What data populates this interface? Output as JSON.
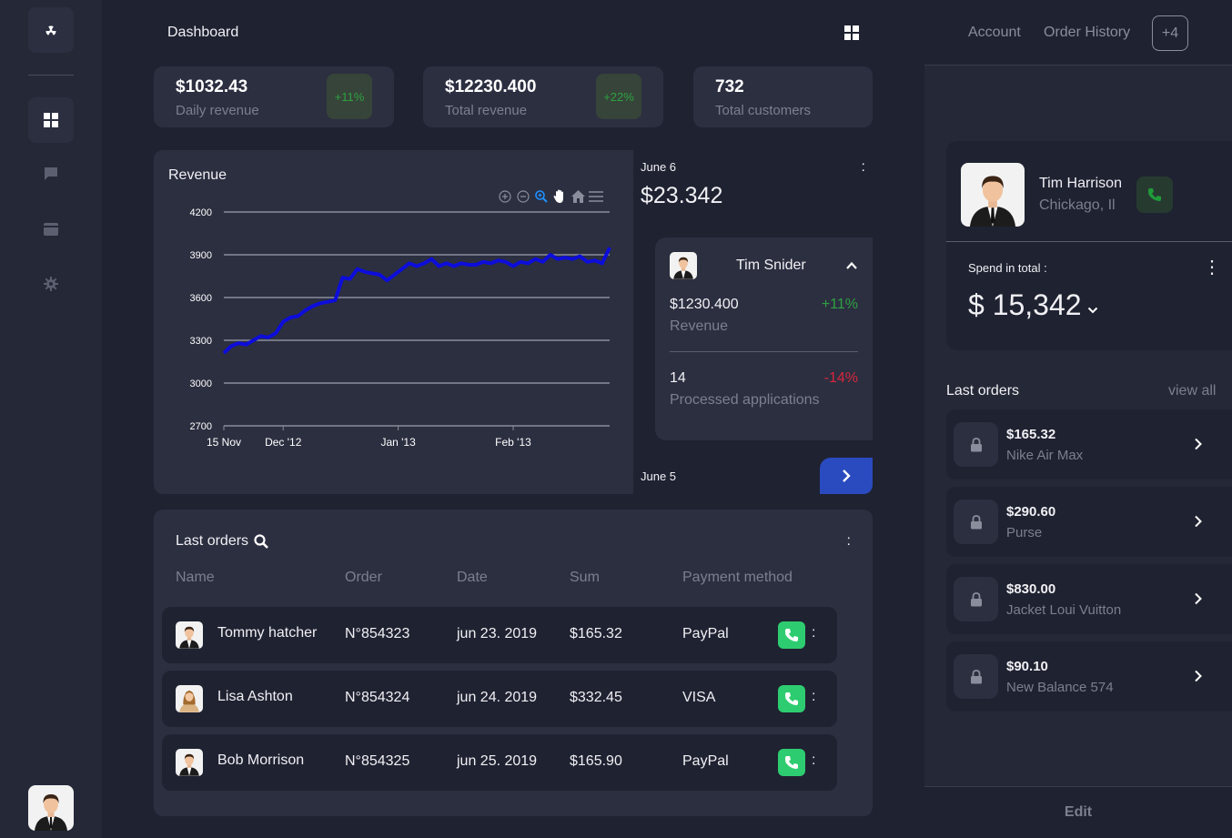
{
  "colors": {
    "background": "#1f2231",
    "card": "#2c2f40",
    "sidebar": "#252837",
    "accent_blue": "#2a4bbf",
    "chart_line": "#0d0ddb",
    "positive": "#2ea142",
    "negative": "#d7263d",
    "phone_green": "#2ecc71"
  },
  "sidebar": {
    "logo_icon": "radiation-icon",
    "items": [
      {
        "icon": "grid-icon",
        "active": true
      },
      {
        "icon": "chat-icon",
        "active": false
      },
      {
        "icon": "card-icon",
        "active": false
      },
      {
        "icon": "gear-icon",
        "active": false
      }
    ]
  },
  "header": {
    "title": "Dashboard",
    "toggle_icon": "grid-icon"
  },
  "stats": [
    {
      "value": "$1032.43",
      "label": "Daily revenue",
      "change": "+11%"
    },
    {
      "value": "$12230.400",
      "label": "Total revenue",
      "change": "+22%"
    },
    {
      "value": "732",
      "label": "Total customers"
    }
  ],
  "revenue": {
    "title": "Revenue",
    "toolbar": [
      "zoom-in-icon",
      "zoom-out-icon",
      "selection-zoom-icon",
      "pan-hand-icon",
      "home-icon",
      "menu-icon"
    ]
  },
  "chart_data": {
    "type": "line",
    "title": "Revenue",
    "xlabel": "",
    "ylabel": "",
    "ylim": [
      2700,
      4200
    ],
    "yticks": [
      2700,
      3000,
      3300,
      3600,
      3900,
      4200
    ],
    "xticks": [
      {
        "label": "15 Nov",
        "date": "2011-11-15"
      },
      {
        "label": "Dec '12",
        "date": "2011-12-01"
      },
      {
        "label": "Jan '13",
        "date": "2012-01-01"
      },
      {
        "label": "Feb '13",
        "date": "2012-02-01"
      }
    ],
    "x_range": [
      "2011-11-15",
      "2012-02-27"
    ],
    "grid": true,
    "series": [
      {
        "name": "",
        "x": [
          "2011-11-15",
          "2011-11-17",
          "2011-11-19",
          "2011-11-21",
          "2011-11-23",
          "2011-11-25",
          "2011-11-27",
          "2011-11-29",
          "2011-12-01",
          "2011-12-03",
          "2011-12-05",
          "2011-12-07",
          "2011-12-09",
          "2011-12-11",
          "2011-12-13",
          "2011-12-15",
          "2011-12-17",
          "2011-12-19",
          "2011-12-21",
          "2011-12-23",
          "2011-12-25",
          "2011-12-27",
          "2011-12-29",
          "2011-12-31",
          "2012-01-02",
          "2012-01-04",
          "2012-01-06",
          "2012-01-08",
          "2012-01-10",
          "2012-01-12",
          "2012-01-14",
          "2012-01-16",
          "2012-01-18",
          "2012-01-20",
          "2012-01-22",
          "2012-01-24",
          "2012-01-26",
          "2012-01-28",
          "2012-01-30",
          "2012-02-01",
          "2012-02-03",
          "2012-02-05",
          "2012-02-07",
          "2012-02-09",
          "2012-02-11",
          "2012-02-13",
          "2012-02-15",
          "2012-02-17",
          "2012-02-19",
          "2012-02-21",
          "2012-02-23",
          "2012-02-25",
          "2012-02-27"
        ],
        "y": [
          3210,
          3260,
          3280,
          3270,
          3300,
          3330,
          3320,
          3350,
          3430,
          3460,
          3470,
          3510,
          3540,
          3560,
          3570,
          3580,
          3740,
          3730,
          3800,
          3780,
          3770,
          3760,
          3720,
          3760,
          3800,
          3840,
          3820,
          3840,
          3870,
          3820,
          3840,
          3820,
          3840,
          3830,
          3830,
          3850,
          3840,
          3860,
          3850,
          3820,
          3850,
          3840,
          3870,
          3850,
          3900,
          3870,
          3880,
          3870,
          3890,
          3850,
          3860,
          3840,
          3950
        ]
      }
    ]
  },
  "day_panel": {
    "date": "June 6",
    "amount": "$23.342",
    "detail": {
      "name": "Tim Snider",
      "revenue_value": "$1230.400",
      "revenue_change": "+11%",
      "revenue_label": "Revenue",
      "apps_value": "14",
      "apps_change": "-14%",
      "apps_label": "Processed applications"
    },
    "next_date": "June 5"
  },
  "last_orders": {
    "title": "Last orders",
    "columns": [
      "Name",
      "Order",
      "Date",
      "Sum",
      "Payment method"
    ],
    "rows": [
      {
        "name": "Tommy hatcher",
        "order": "N°854323",
        "date": "jun 23. 2019",
        "sum": "$165.32",
        "payment": "PayPal"
      },
      {
        "name": "Lisa Ashton",
        "order": "N°854324",
        "date": "jun 24. 2019",
        "sum": "$332.45",
        "payment": "VISA"
      },
      {
        "name": "Bob Morrison",
        "order": "N°854325",
        "date": "jun 25. 2019",
        "sum": "$165.90",
        "payment": "PayPal"
      }
    ]
  },
  "right_panel": {
    "tabs": [
      "Account",
      "Order History"
    ],
    "more": "+4",
    "profile": {
      "name": "Tim Harrison",
      "city": "Chickago, Il",
      "spend_label": "Spend in total :",
      "spend_value": "$ 15,342"
    },
    "orders_title": "Last orders",
    "view_all": "view all",
    "orders": [
      {
        "price": "$165.32",
        "name": "Nike Air Max"
      },
      {
        "price": "$290.60",
        "name": "Purse"
      },
      {
        "price": "$830.00",
        "name": "Jacket Loui Vuitton"
      },
      {
        "price": "$90.10",
        "name": "New Balance 574"
      }
    ],
    "edit": "Edit"
  }
}
